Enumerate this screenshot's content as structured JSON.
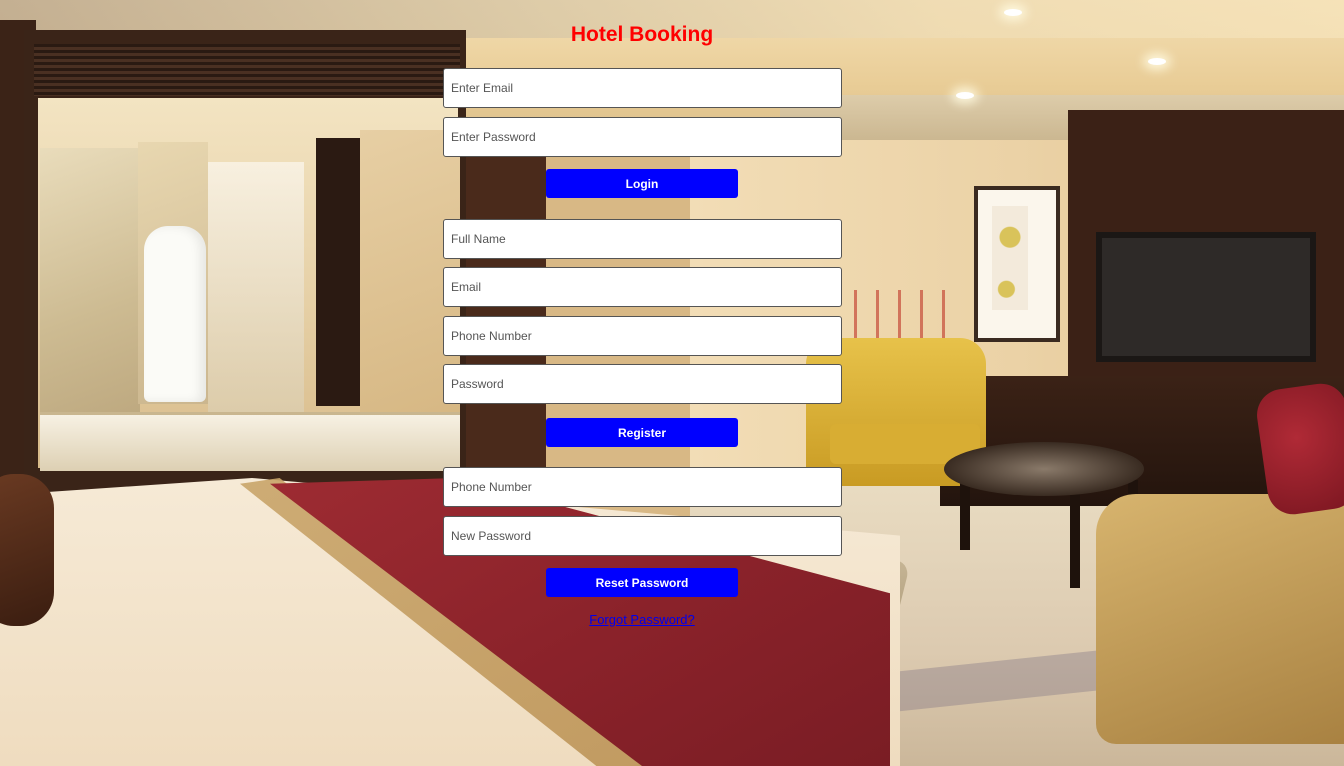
{
  "page": {
    "title": "Hotel Booking"
  },
  "login": {
    "email_placeholder": "Enter Email",
    "password_placeholder": "Enter Password",
    "submit_label": "Login"
  },
  "register": {
    "fullname_placeholder": "Full Name",
    "email_placeholder": "Email",
    "phone_placeholder": "Phone Number",
    "password_placeholder": "Password",
    "submit_label": "Register"
  },
  "reset": {
    "phone_placeholder": "Phone Number",
    "new_password_placeholder": "New Password",
    "submit_label": "Reset Password",
    "forgot_link": "Forgot Password?"
  },
  "colors": {
    "title": "#ff0000",
    "button_bg": "#0000ff",
    "button_text": "#ffffff",
    "link": "#0000ee"
  }
}
